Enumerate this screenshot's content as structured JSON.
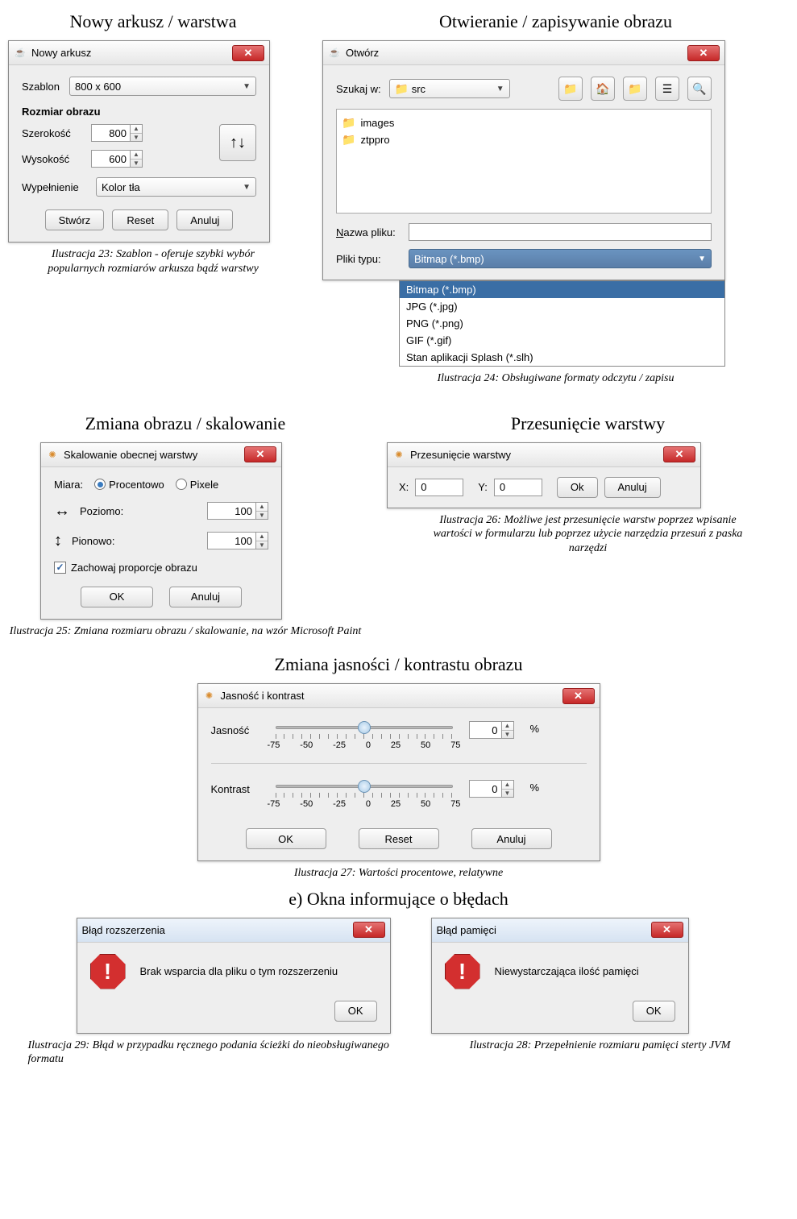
{
  "headings": {
    "nowy": "Nowy arkusz / warstwa",
    "otwieranie": "Otwieranie / zapisywanie obrazu",
    "zmiana_skal": "Zmiana obrazu / skalowanie",
    "przesuniecie": "Przesunięcie warstwy",
    "jasnosc": "Zmiana jasności / kontrastu obrazu",
    "bledy": "e) Okna informujące o błędach"
  },
  "captions": {
    "c23": "Ilustracja 23: Szablon - oferuje szybki wybór popularnych rozmiarów arkusza bądź warstwy",
    "c24": "Ilustracja 24: Obsługiwane formaty odczytu / zapisu",
    "c25": "Ilustracja 25: Zmiana rozmiaru obrazu / skalowanie, na wzór Microsoft Paint",
    "c26": "Ilustracja 26: Możliwe jest przesunięcie warstw poprzez wpisanie wartości w formularzu lub poprzez użycie narzędzia przesuń z paska narzędzi",
    "c27": "Ilustracja 27: Wartości procentowe, relatywne",
    "c28": "Ilustracja 28: Przepełnienie rozmiaru pamięci sterty JVM",
    "c29": "Ilustracja 29: Błąd w przypadku ręcznego podania ścieżki do nieobsługiwanego formatu"
  },
  "nowy": {
    "title": "Nowy arkusz",
    "szablon_label": "Szablon",
    "szablon_value": "800 x 600",
    "rozmiar_label": "Rozmiar obrazu",
    "szer_label": "Szerokość",
    "szer_val": "800",
    "wys_label": "Wysokość",
    "wys_val": "600",
    "wyp_label": "Wypełnienie",
    "wyp_value": "Kolor tła",
    "btn_stworz": "Stwórz",
    "btn_reset": "Reset",
    "btn_anuluj": "Anuluj"
  },
  "otworz": {
    "title": "Otwórz",
    "szukaj_label": "Szukaj w:",
    "szukaj_value": "src",
    "items": [
      "images",
      "ztppro"
    ],
    "nazwa_label": "Nazwa pliku:",
    "nazwa_value": "",
    "typ_label": "Pliki typu:",
    "typ_value": "Bitmap (*.bmp)",
    "options": [
      "Bitmap (*.bmp)",
      "JPG (*.jpg)",
      "PNG (*.png)",
      "GIF (*.gif)",
      "Stan aplikacji Splash (*.slh)"
    ]
  },
  "skal": {
    "title": "Skalowanie obecnej warstwy",
    "miara_label": "Miara:",
    "radio_proc": "Procentowo",
    "radio_pix": "Pixele",
    "poziomo_label": "Poziomo:",
    "poziomo_val": "100",
    "pionowo_label": "Pionowo:",
    "pionowo_val": "100",
    "zachowaj": "Zachowaj proporcje obrazu",
    "btn_ok": "OK",
    "btn_anuluj": "Anuluj"
  },
  "przes": {
    "title": "Przesunięcie warstwy",
    "x_label": "X:",
    "x_val": "0",
    "y_label": "Y:",
    "y_val": "0",
    "btn_ok": "Ok",
    "btn_anuluj": "Anuluj"
  },
  "jas": {
    "title": "Jasność i kontrast",
    "jasnosc_label": "Jasność",
    "kontrast_label": "Kontrast",
    "jasnosc_val": "0",
    "kontrast_val": "0",
    "pct": "%",
    "ticks": [
      "-75",
      "-50",
      "-25",
      "0",
      "25",
      "50",
      "75"
    ],
    "btn_ok": "OK",
    "btn_reset": "Reset",
    "btn_anuluj": "Anuluj"
  },
  "err_ext": {
    "title": "Błąd rozszerzenia",
    "msg": "Brak wsparcia dla pliku o tym rozszerzeniu",
    "ok": "OK"
  },
  "err_mem": {
    "title": "Błąd pamięci",
    "msg": "Niewystarczająca ilość pamięci",
    "ok": "OK"
  }
}
